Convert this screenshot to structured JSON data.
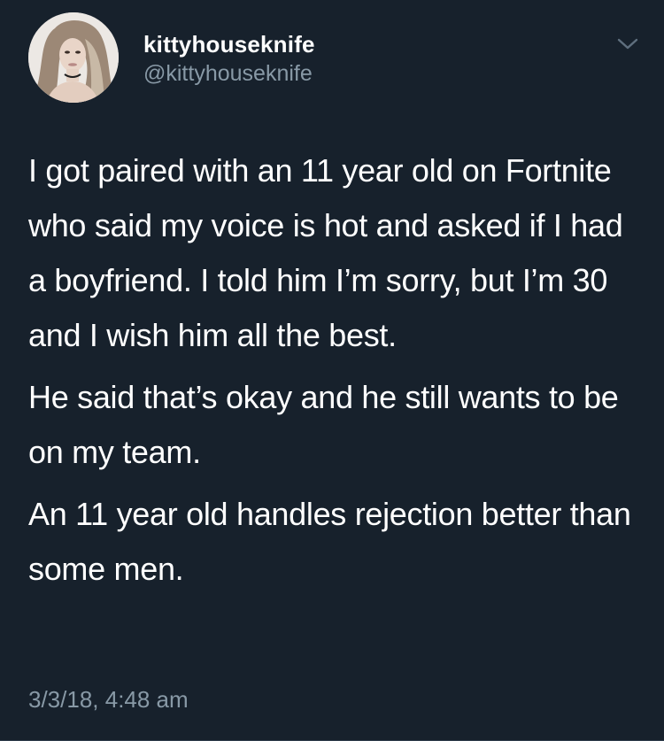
{
  "user": {
    "display_name": "kittyhouseknife",
    "handle": "@kittyhouseknife"
  },
  "tweet": {
    "paragraphs": [
      "I got paired with an 11 year old on Fortnite who said my voice is hot and asked if I had a boyfriend. I told him I’m sorry, but I’m 30 and I wish him all the best.",
      "He said that’s okay and he still wants to be on my team.",
      "An 11 year old handles rejection better than some men."
    ],
    "timestamp": "3/3/18, 4:48 am"
  },
  "icons": {
    "menu": "chevron-down-icon",
    "avatar": "profile-photo"
  },
  "colors": {
    "background": "#17212c",
    "text": "#ffffff",
    "secondary_text": "#8899a6"
  }
}
